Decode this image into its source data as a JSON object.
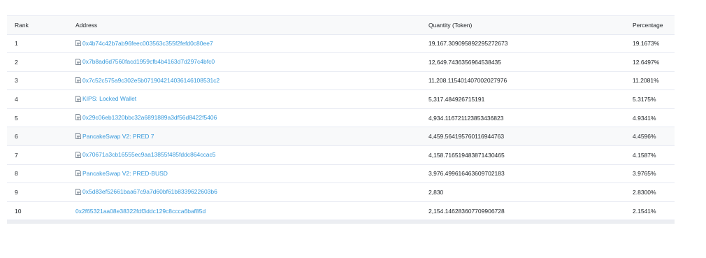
{
  "table": {
    "headers": {
      "rank": "Rank",
      "address": "Address",
      "quantity": "Quantity (Token)",
      "percentage": "Percentage"
    },
    "rows": [
      {
        "rank": "1",
        "address": "0x4b74c42b7ab96feec003563c355f2fefd0c80ee7",
        "contract": true,
        "quantity": "19,167.309095892295272673",
        "percentage": "19.1673%"
      },
      {
        "rank": "2",
        "address": "0x7b8ad6d7560facd1959cfb4b4163d7d297c4bfc0",
        "contract": true,
        "quantity": "12,649.7436356964538435",
        "percentage": "12.6497%"
      },
      {
        "rank": "3",
        "address": "0x7c52c575a9c302e5b071904214036146108531c2",
        "contract": true,
        "quantity": "11,208.115401407002027976",
        "percentage": "11.2081%"
      },
      {
        "rank": "4",
        "address": "KIPS: Locked Wallet",
        "contract": true,
        "quantity": "5,317.484926715191",
        "percentage": "5.3175%"
      },
      {
        "rank": "5",
        "address": "0x29c06eb1320bbc32a6891889a3df56d8422f5406",
        "contract": true,
        "quantity": "4,934.116721123853436823",
        "percentage": "4.9341%"
      },
      {
        "rank": "6",
        "address": "PancakeSwap V2: PRED 7",
        "contract": true,
        "quantity": "4,459.564195760116944763",
        "percentage": "4.4596%"
      },
      {
        "rank": "7",
        "address": "0x70671a3cb16555ec9aa13855f485fddc864ccac5",
        "contract": true,
        "quantity": "4,158.716519483871430465",
        "percentage": "4.1587%"
      },
      {
        "rank": "8",
        "address": "PancakeSwap V2: PRED-BUSD",
        "contract": true,
        "quantity": "3,976.499616463609702183",
        "percentage": "3.9765%"
      },
      {
        "rank": "9",
        "address": "0x5d83ef52661baa67c9a7d60bf61b8339622603b6",
        "contract": true,
        "quantity": "2,830",
        "percentage": "2.8300%"
      },
      {
        "rank": "10",
        "address": "0x2f65321aa08e38322fdf3ddc129c8ccca6baf85d",
        "contract": false,
        "quantity": "2,154.146283607709906728",
        "percentage": "2.1541%"
      }
    ]
  },
  "colors": {
    "link": "#3498db",
    "text": "#212529",
    "header_bg": "#f8f9fa",
    "border": "#e7eaf3"
  },
  "icons": {
    "contract": "document-icon"
  }
}
